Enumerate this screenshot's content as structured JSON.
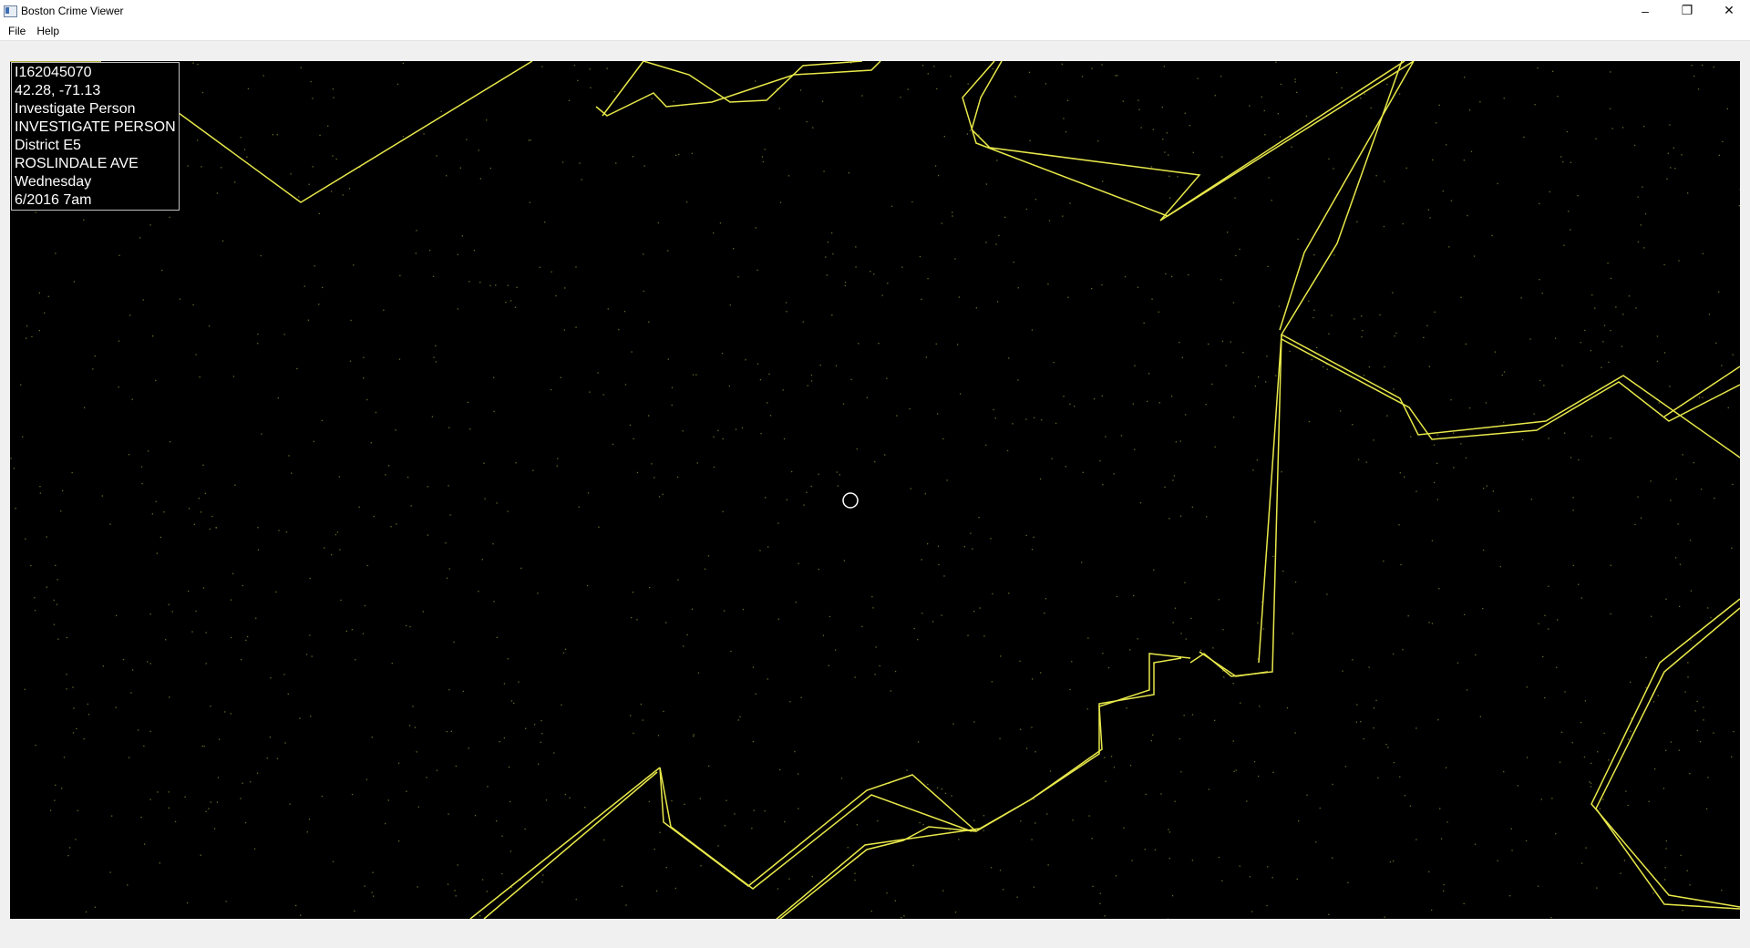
{
  "window": {
    "title": "Boston Crime Viewer",
    "controls": {
      "minimize": "–",
      "restore": "❐",
      "close": "✕"
    }
  },
  "menu": {
    "items": [
      {
        "label": "File"
      },
      {
        "label": "Help"
      }
    ]
  },
  "map": {
    "colors": {
      "background": "#000000",
      "boundary": "#e8e84a",
      "incident_dot": "#6b6b2a",
      "cursor": "#ffffff"
    },
    "selected_incident": {
      "incident_number": "I162045070",
      "coordinates": "42.28, -71.13",
      "offense_group": "Investigate Person",
      "offense_description": "INVESTIGATE PERSON",
      "district": "District E5",
      "street": "ROSLINDALE AVE",
      "day_of_week": "Wednesday",
      "date_time": "6/2016 7am"
    }
  }
}
